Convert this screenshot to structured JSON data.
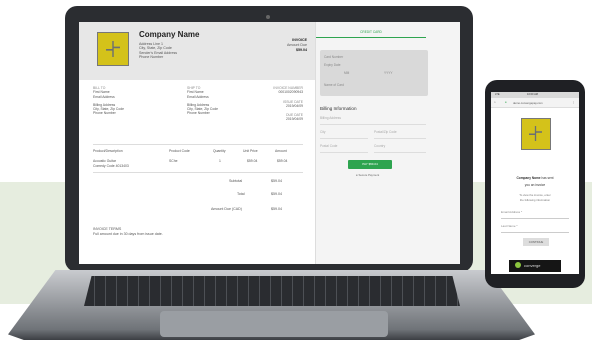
{
  "invoice": {
    "company_name": "Company Name",
    "address_lines": [
      "Address Line 1",
      "City, State, Zip Code",
      "Sender's Email Address",
      "Phone Number"
    ],
    "invoice_label": "INVOICE",
    "amount_due_label": "Amount Due",
    "amount_due_value": "$59.04",
    "bill_to": {
      "heading": "BILL TO",
      "lines": [
        "First Name",
        "Email Address",
        "",
        "Billing Address",
        "City, State, Zip Code",
        "Phone Number"
      ]
    },
    "ship_to": {
      "heading": "SHIP TO",
      "lines": [
        "First Name",
        "Email Address",
        "",
        "Billing Address",
        "City, State, Zip Code",
        "Phone Number"
      ]
    },
    "meta": {
      "invoice_number_label": "INVOICE NUMBER",
      "invoice_number": "0001002090943",
      "issue_date_label": "ISSUE DATE",
      "issue_date": "2019/04/09",
      "due_date_label": "DUE DATE",
      "due_date": "2019/04/09"
    },
    "table": {
      "headers": [
        "Product/Description",
        "Product Code",
        "Quantity",
        "Unit Price",
        "Amount"
      ],
      "rows": [
        [
          "Acoustic Guitar",
          "SChe",
          "1",
          "$59.04",
          "$59.04"
        ]
      ],
      "row_note": "Comedy Code 4013403"
    },
    "totals": [
      {
        "label": "Subtotal",
        "value": "$59.04"
      },
      {
        "label": "Total",
        "value": "$59.04"
      },
      {
        "label": "Amount Due (CAD)",
        "value": "$59.04"
      }
    ],
    "terms_heading": "INVOICE TERMS",
    "terms_text": "Full amount due in 30 days from issue date."
  },
  "payment": {
    "tab_label": "CREDIT CARD",
    "card_fields": [
      "Card Number",
      "Expiry Date",
      "Name of Card"
    ],
    "expiry_selects": [
      "MM",
      "YYYY"
    ],
    "billing_title": "Billing Information",
    "billing_fields": [
      "Billing Address",
      "City",
      "Postal/Zip Code",
      "Postal Code",
      "Country"
    ],
    "pay_button": "PAY $59.04",
    "secure_text": "Secure Payment"
  },
  "phone": {
    "status_time": "10:00 AM",
    "status_signal": "LTE",
    "url": "demo.convergepay.com",
    "headline_bold": "Company Name",
    "headline_rest": "has sent",
    "headline_line2": "you an invoice",
    "sub_lines": [
      "To view the invoice, enter",
      "the following information"
    ],
    "email_label": "Email Address *",
    "name_label": "Last Name *",
    "continue_button": "CONTINUE",
    "brand": "converge"
  }
}
